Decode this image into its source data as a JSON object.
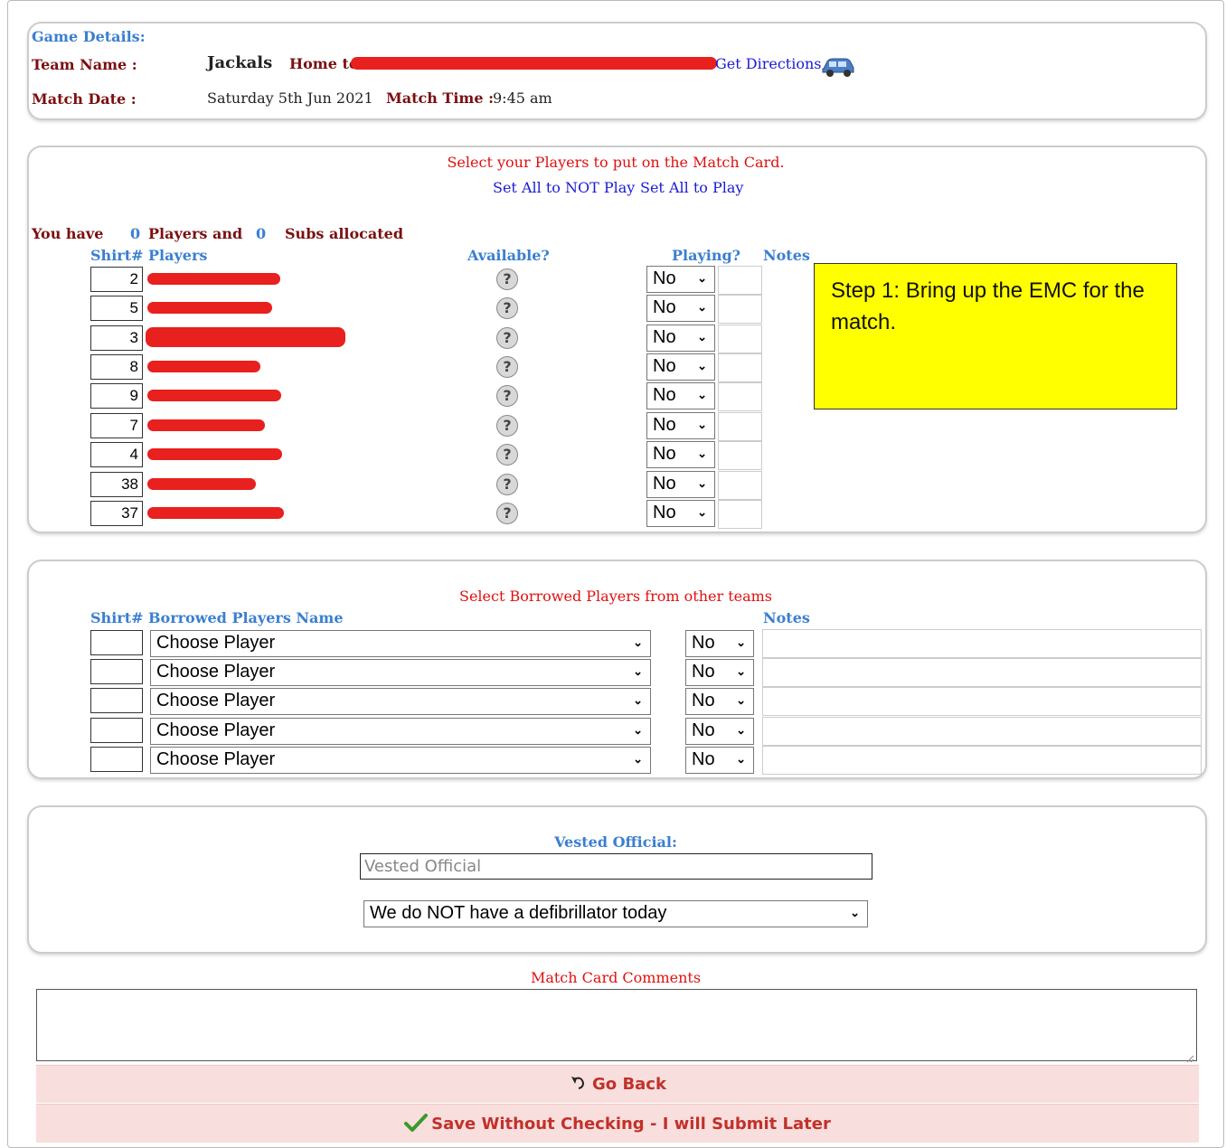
{
  "game": {
    "section_title": "Game Details:",
    "team_name_label": "Team Name :",
    "team_name": "Jackals",
    "home_to": "Home to",
    "directions_link": "Get Directions",
    "match_date_label": "Match Date :",
    "match_date": "Saturday 5th Jun 2021",
    "match_time_label": "Match Time :",
    "match_time": "9:45 am"
  },
  "players_panel": {
    "instruction": "Select your Players to put on the Match Card.",
    "set_all_not_play": "Set All to NOT Play",
    "set_all_play": "Set All to Play",
    "you_have": "You have",
    "players_count": "0",
    "players_and": "Players and",
    "subs_count": "0",
    "subs_allocated": "Subs allocated",
    "headers": {
      "shirt": "Shirt#",
      "players": "Players",
      "available": "Available?",
      "playing": "Playing?",
      "notes": "Notes"
    },
    "rows": [
      {
        "shirt": "2",
        "playing": "No"
      },
      {
        "shirt": "5",
        "playing": "No"
      },
      {
        "shirt": "3",
        "playing": "No"
      },
      {
        "shirt": "8",
        "playing": "No"
      },
      {
        "shirt": "9",
        "playing": "No"
      },
      {
        "shirt": "7",
        "playing": "No"
      },
      {
        "shirt": "4",
        "playing": "No"
      },
      {
        "shirt": "38",
        "playing": "No"
      },
      {
        "shirt": "37",
        "playing": "No"
      }
    ],
    "available_icon": "question-icon"
  },
  "callout": {
    "text": "Step 1:  Bring up the EMC for the match.",
    "color": "#ffff00"
  },
  "borrowed_panel": {
    "instruction": "Select Borrowed Players from other teams",
    "headers": {
      "shirt": "Shirt#",
      "name": "Borrowed Players Name",
      "notes": "Notes"
    },
    "rows": [
      {
        "player": "Choose Player",
        "playing": "No"
      },
      {
        "player": "Choose Player",
        "playing": "No"
      },
      {
        "player": "Choose Player",
        "playing": "No"
      },
      {
        "player": "Choose Player",
        "playing": "No"
      },
      {
        "player": "Choose Player",
        "playing": "No"
      }
    ]
  },
  "official_panel": {
    "label": "Vested Official:",
    "placeholder": "Vested Official",
    "defib_selected": "We do NOT have a defibrillator today"
  },
  "comments": {
    "label": "Match Card Comments"
  },
  "buttons": {
    "go_back": "Go Back",
    "save_later": "Save Without Checking - I will Submit Later"
  },
  "colors": {
    "accent_blue": "#3a7fd0",
    "maroon": "#7a1010",
    "red": "#e01010",
    "button_bg": "#f9dede"
  }
}
